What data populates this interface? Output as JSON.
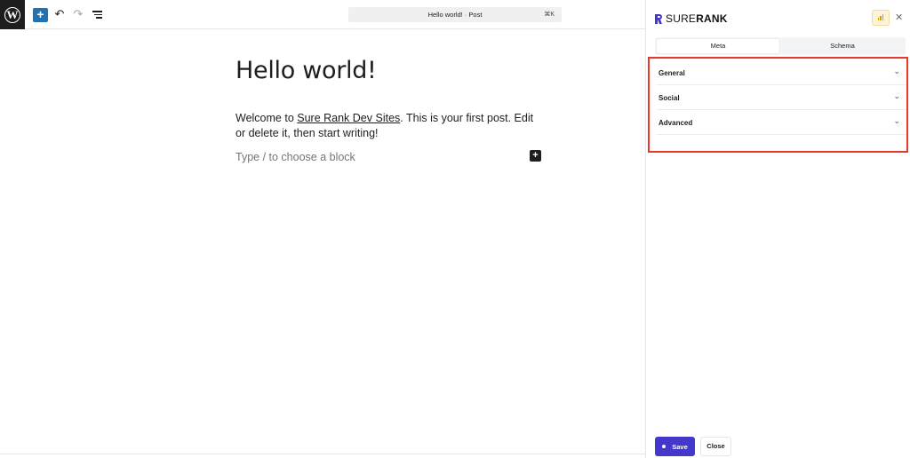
{
  "editor": {
    "command_bar": {
      "title": "Hello world! · Post",
      "shortcut": "⌘K"
    },
    "post": {
      "title": "Hello world!",
      "paragraph_before_link": "Welcome to ",
      "link_text": "Sure Rank Dev Sites",
      "paragraph_after_link": ". This is your first post. Edit or delete it, then start writing!",
      "block_placeholder": "Type / to choose a block"
    },
    "icons": {
      "wp_logo": "wordpress-logo-icon",
      "add": "plus-icon",
      "undo": "undo-icon",
      "redo": "redo-icon",
      "list_view": "list-view-icon",
      "inline_add": "plus-icon"
    }
  },
  "sidebar": {
    "brand": {
      "prefix": "SURE",
      "suffix": "RANK"
    },
    "tabs": [
      {
        "label": "Meta",
        "active": true
      },
      {
        "label": "Schema",
        "active": false
      }
    ],
    "accordion": [
      {
        "label": "General"
      },
      {
        "label": "Social"
      },
      {
        "label": "Advanced"
      }
    ],
    "footer": {
      "save_label": "Save",
      "close_label": "Close"
    },
    "colors": {
      "brand": "#4338ca",
      "highlight": "#e53a2b",
      "score_bg": "#fdf3d6"
    }
  }
}
